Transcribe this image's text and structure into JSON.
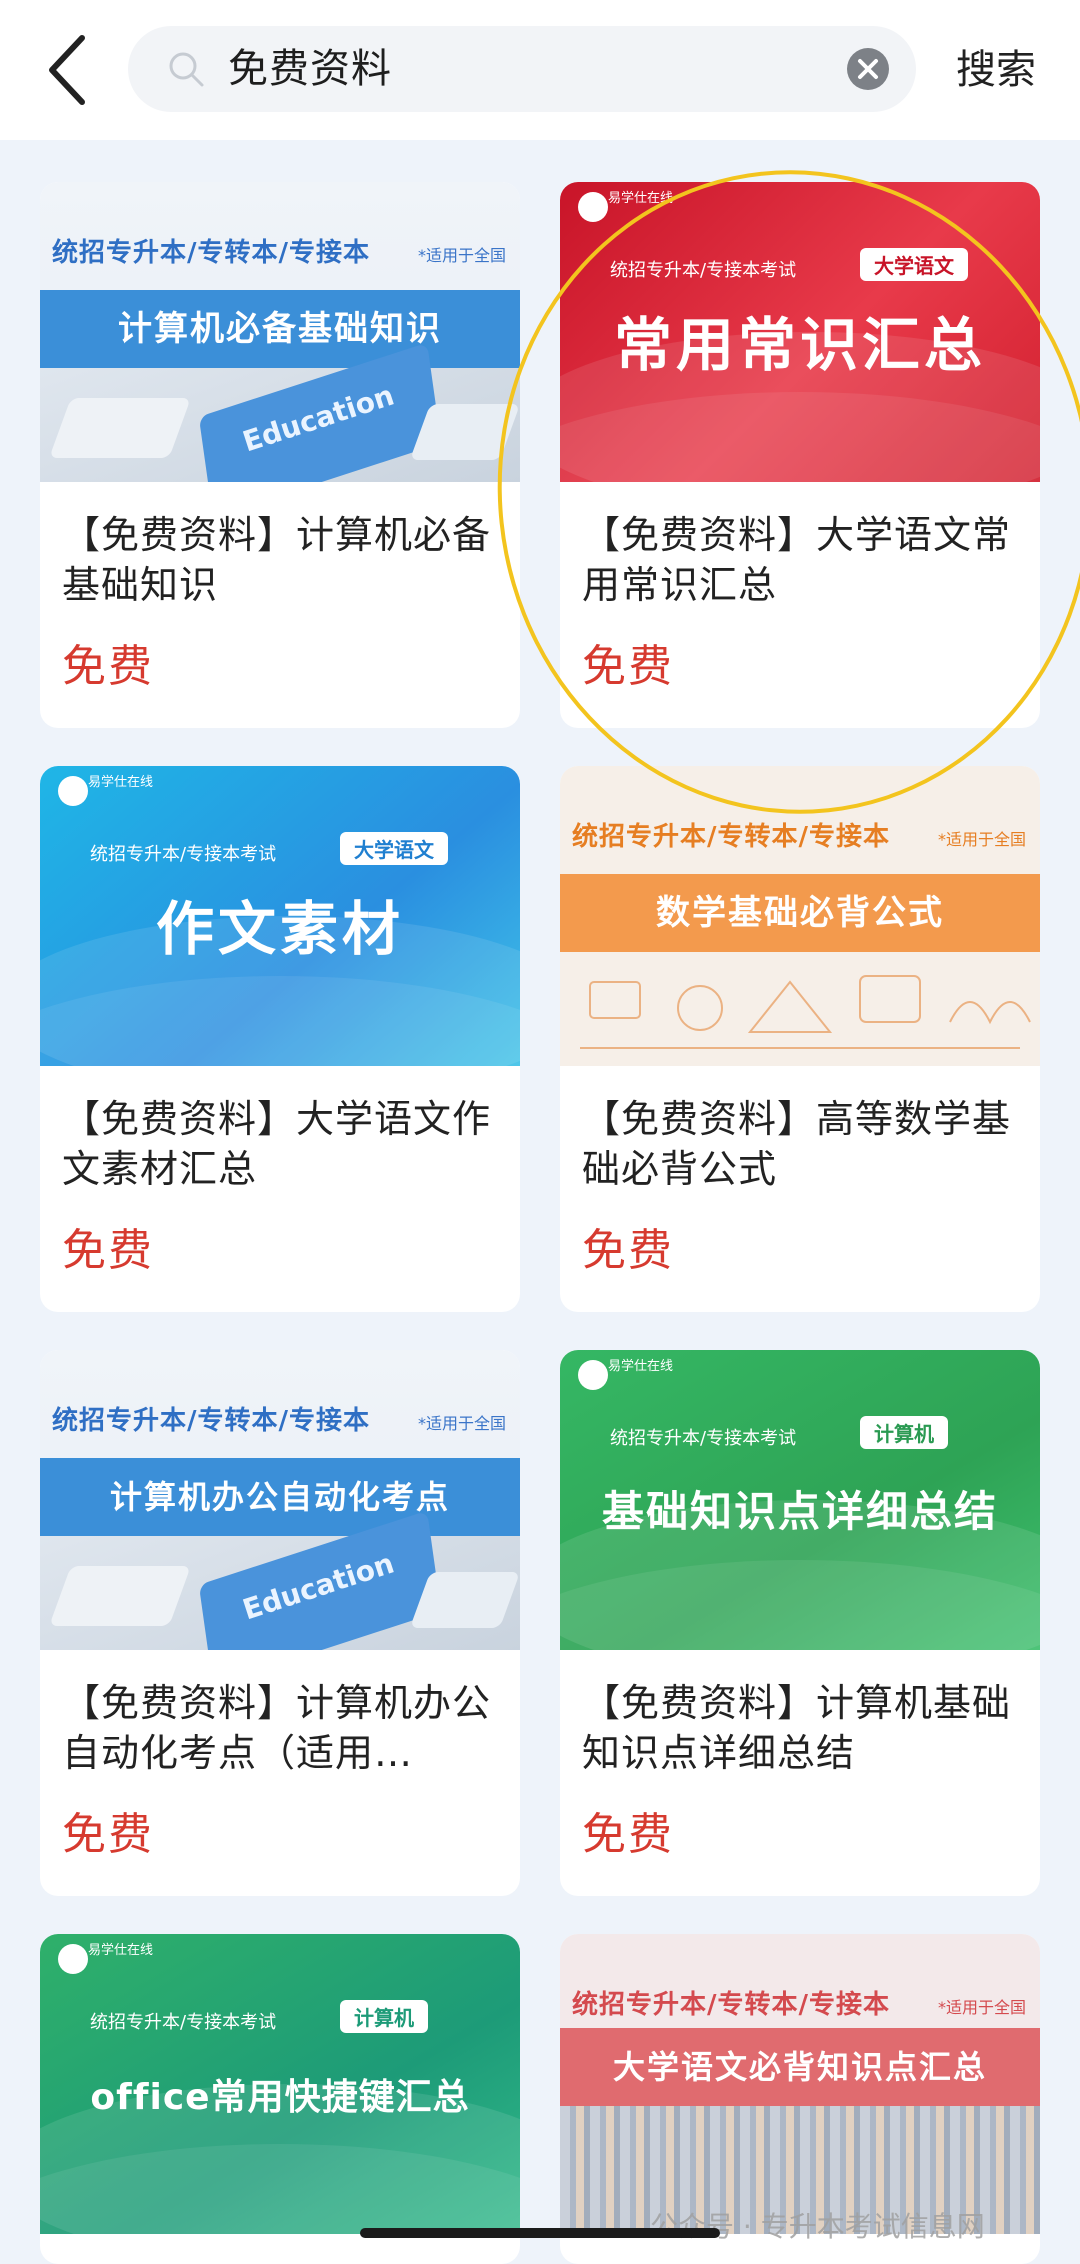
{
  "search": {
    "query": "免费资料",
    "submit_label": "搜索"
  },
  "icons": {
    "back": "chevron-left-icon",
    "search": "search-icon",
    "clear": "clear-icon"
  },
  "colors": {
    "price": "#d63a2f",
    "highlight": "#f3c41e"
  },
  "cards": [
    {
      "title": "【免费资料】计算机必备基础知识",
      "price": "免费",
      "banner": {
        "head": "统招专升本/专转本/专接本",
        "note": "*适用于全国",
        "main": "计算机必备基础知识",
        "key_label": "Education"
      }
    },
    {
      "title": "【免费资料】大学语文常用常识汇总",
      "price": "免费",
      "banner": {
        "logo": "易学仕在线",
        "sub": "统招专升本/专接本考试",
        "badge": "大学语文",
        "main": "常用常识汇总"
      }
    },
    {
      "title": "【免费资料】大学语文作文素材汇总",
      "price": "免费",
      "banner": {
        "logo": "易学仕在线",
        "sub": "统招专升本/专接本考试",
        "badge": "大学语文",
        "main": "作文素材"
      }
    },
    {
      "title": "【免费资料】高等数学基础必背公式",
      "price": "免费",
      "banner": {
        "head": "统招专升本/专转本/专接本",
        "note": "*适用于全国",
        "main": "数学基础必背公式"
      }
    },
    {
      "title": "【免费资料】计算机办公自动化考点（适用…",
      "price": "免费",
      "banner": {
        "head": "统招专升本/专转本/专接本",
        "note": "*适用于全国",
        "main": "计算机办公自动化考点",
        "key_label": "Education"
      }
    },
    {
      "title": "【免费资料】计算机基础知识点详细总结",
      "price": "免费",
      "banner": {
        "logo": "易学仕在线",
        "sub": "统招专升本/专接本考试",
        "badge": "计算机",
        "main": "基础知识点详细总结"
      }
    },
    {
      "banner": {
        "logo": "易学仕在线",
        "sub": "统招专升本/专接本考试",
        "badge": "计算机",
        "main": "office常用快捷键汇总"
      }
    },
    {
      "banner": {
        "head": "统招专升本/专转本/专接本",
        "note": "*适用于全国",
        "main": "大学语文必背知识点汇总"
      }
    }
  ],
  "watermark": "公众号 · 专升本考试信息网"
}
